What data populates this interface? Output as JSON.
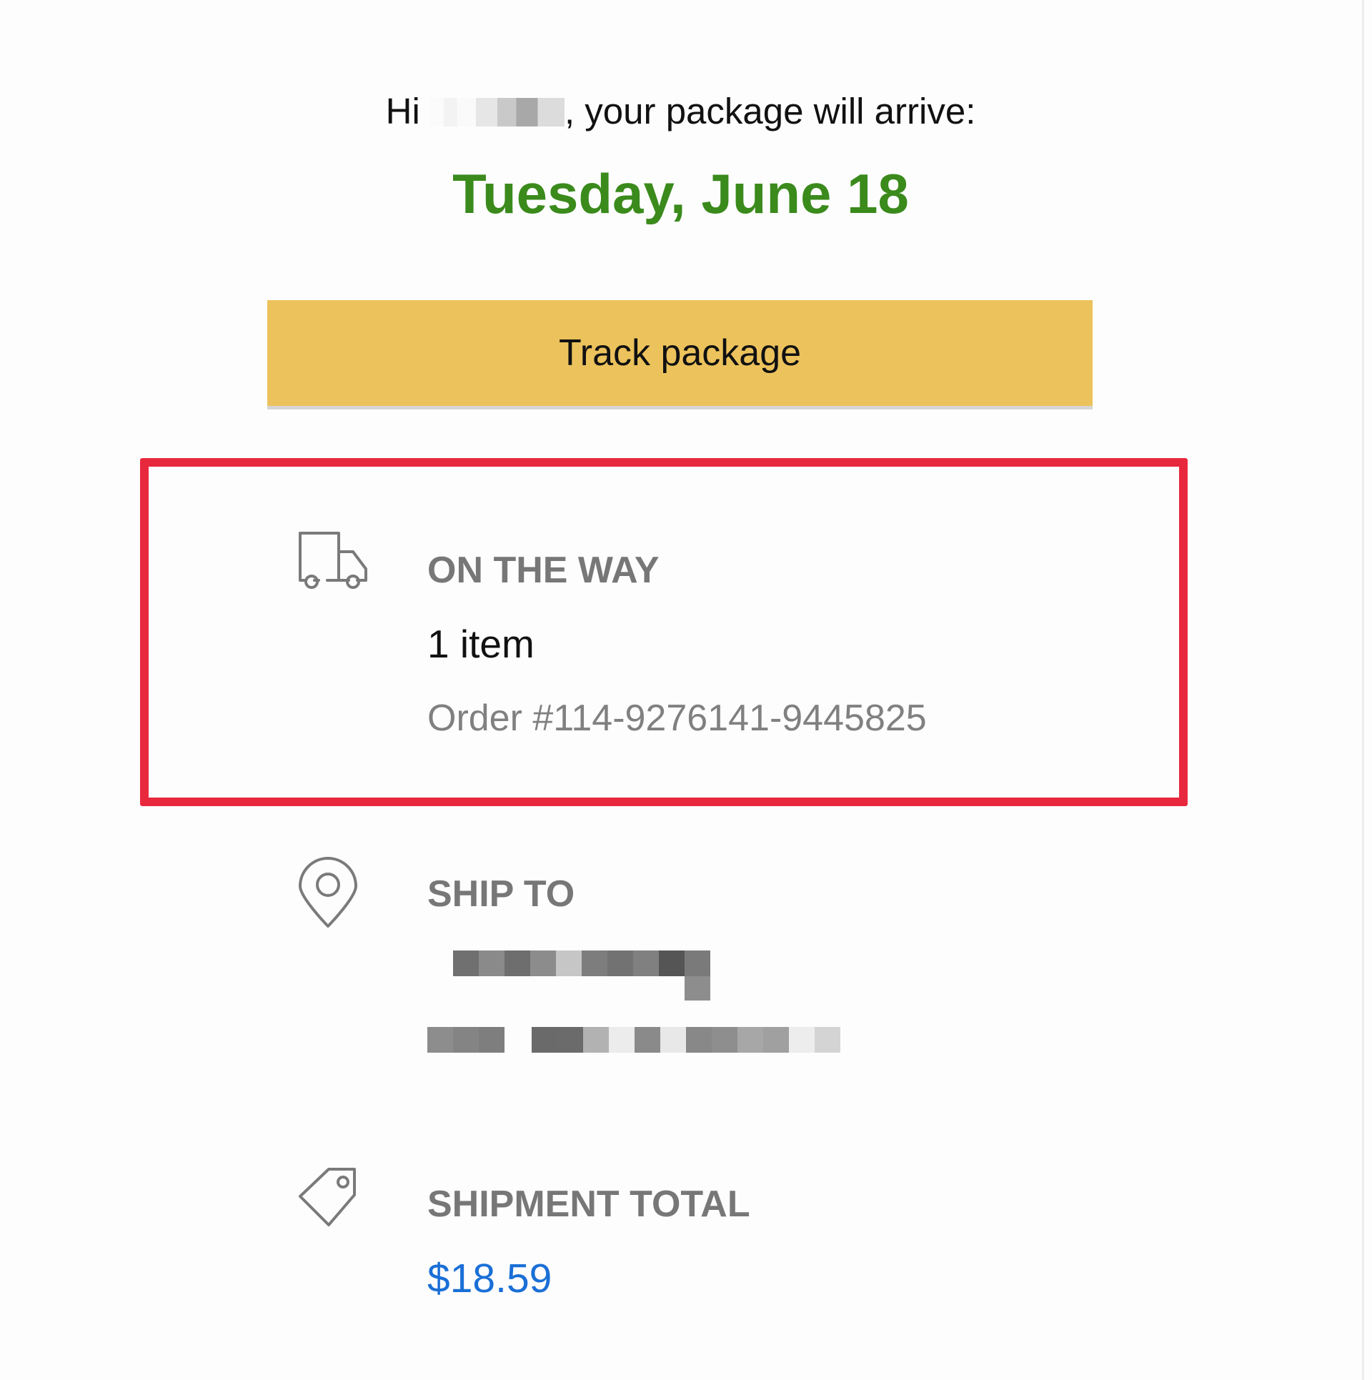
{
  "header": {
    "greeting_prefix": "Hi",
    "greeting_suffix": ", your package will arrive:",
    "arrival_date": "Tuesday, June 18",
    "date_color": "#3a8a1c"
  },
  "actions": {
    "track_label": "Track package",
    "button_color": "#ecc25c"
  },
  "shipment_status": {
    "icon": "delivery-truck-icon",
    "label": "ON THE WAY",
    "item_count": "1 item",
    "order_number": "Order #114-9276141-9445825",
    "highlight_color": "#e8283d"
  },
  "ship_to": {
    "icon": "location-pin-icon",
    "label": "SHIP TO"
  },
  "shipment_total": {
    "icon": "price-tag-icon",
    "label": "SHIPMENT TOTAL",
    "amount": "$18.59",
    "amount_color": "#1a6fd6"
  }
}
